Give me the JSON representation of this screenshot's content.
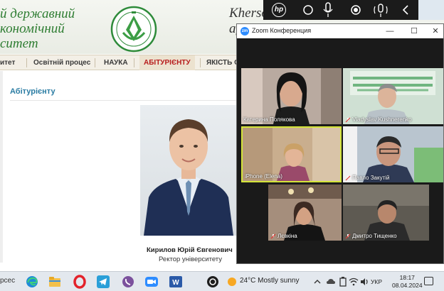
{
  "site": {
    "name_ua": [
      "й державний",
      "кономічний",
      "ситет"
    ],
    "name_en": [
      "Kherso",
      "agrari"
    ],
    "nav": [
      "итет",
      "Освітній процес",
      "НАУКА",
      "АБІТУРІЄНТУ",
      "ЯКІСТЬ О"
    ],
    "active_nav": "АБІТУРІЄНТУ",
    "section_title": "Абітурієнту",
    "rector_name": "Кирилов Юрій Євгенович",
    "rector_role": "Ректор університету"
  },
  "zoom": {
    "title": "Zoom Конференция",
    "participants": [
      {
        "name": "Катерина Полякова",
        "muted": false
      },
      {
        "name": "Vladyslav Kushnerenko",
        "muted": true
      },
      {
        "name": "iPhone (Elena)",
        "muted": false,
        "active": true
      },
      {
        "name": "Павло Закутій",
        "muted": true
      },
      {
        "name": "Лєвкіна",
        "muted": true
      },
      {
        "name": "Дмитро Тищенко",
        "muted": true
      }
    ],
    "banner_text": [
      "ХЕРСОНСЬКИЙ ДЕРЖА",
      "АГРАРНО-ЕКОНОМІ",
      "УНІВЕРСИТЕТ"
    ]
  },
  "taskbar": {
    "search_tail": "рсес",
    "weather": "24°C  Mostly sunny",
    "lang": "УКР",
    "time": "18:17",
    "date": "08.04.2024"
  },
  "colors": {
    "zoom_blue": "#2d8cff",
    "active_speaker": "#d4e43a",
    "nav_active": "#b71c1c",
    "section_title": "#2a7ca3",
    "uni_green": "#2e7d32"
  }
}
